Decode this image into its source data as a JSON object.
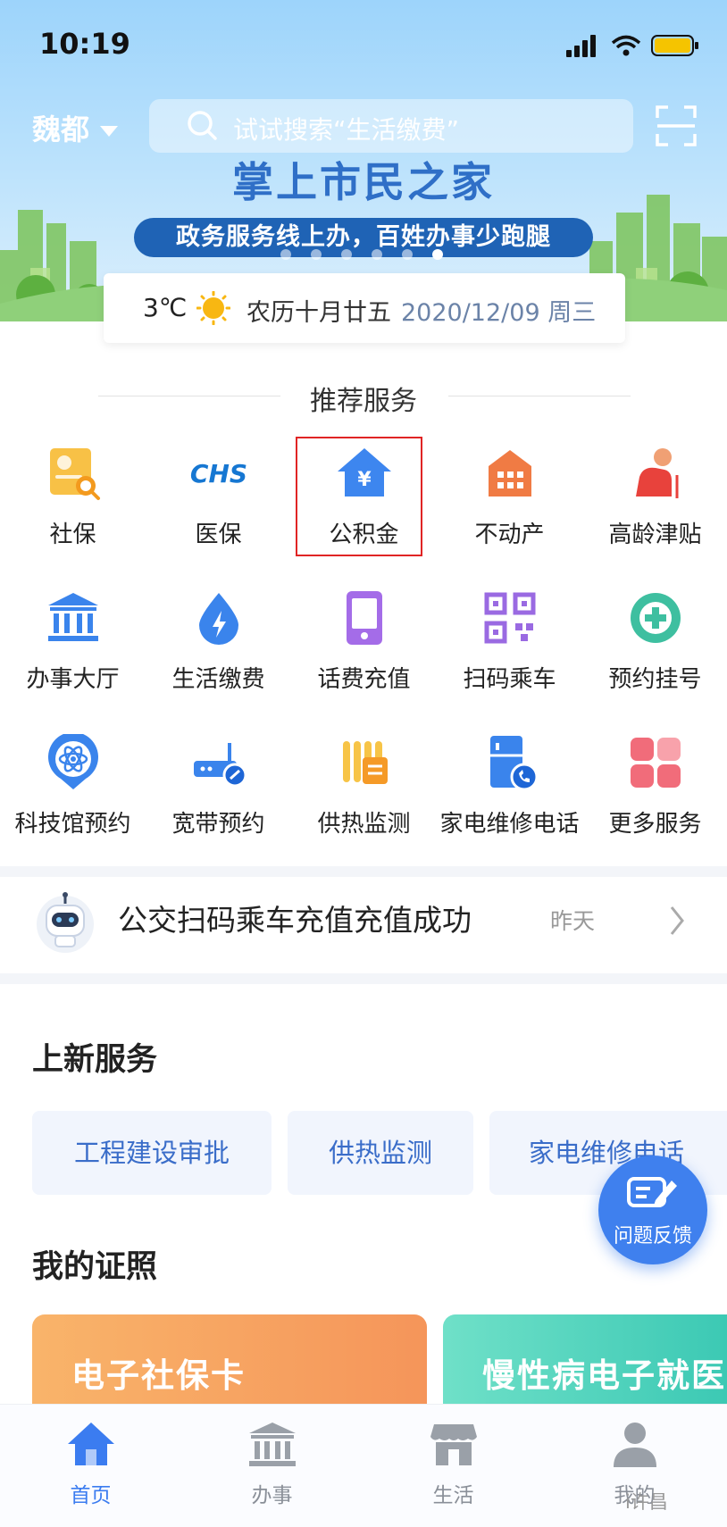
{
  "status_bar": {
    "time": "10:19"
  },
  "header": {
    "city": "魏都",
    "search_placeholder": "试试搜索“生活缴费”",
    "banner_title": "掌上市民之家",
    "banner_slogan": "政务服务线上办，百姓办事少跑腿",
    "banner_slide_count": 6,
    "banner_active_index": 5
  },
  "weather": {
    "temperature": "3℃",
    "lunar_date": "农历十月廿五",
    "date": "2020/12/09 周三"
  },
  "recommended": {
    "title": "推荐服务",
    "items": [
      {
        "label": "社保",
        "icon": "social-security-card-icon"
      },
      {
        "label": "医保",
        "icon": "medical-insurance-chs-icon"
      },
      {
        "label": "公积金",
        "icon": "housing-fund-house-icon"
      },
      {
        "label": "不动产",
        "icon": "real-estate-building-icon"
      },
      {
        "label": "高龄津贴",
        "icon": "elderly-allowance-icon"
      },
      {
        "label": "办事大厅",
        "icon": "government-hall-icon"
      },
      {
        "label": "生活缴费",
        "icon": "utility-payment-icon"
      },
      {
        "label": "话费充值",
        "icon": "phone-recharge-icon"
      },
      {
        "label": "扫码乘车",
        "icon": "qr-code-icon"
      },
      {
        "label": "预约挂号",
        "icon": "medical-appointment-icon"
      },
      {
        "label": "科技馆预约",
        "icon": "science-museum-icon"
      },
      {
        "label": "宽带预约",
        "icon": "broadband-router-icon"
      },
      {
        "label": "供热监测",
        "icon": "heating-radiator-icon"
      },
      {
        "label": "家电维修电话",
        "icon": "appliance-repair-icon"
      },
      {
        "label": "更多服务",
        "icon": "more-services-grid-icon"
      }
    ],
    "highlighted_item": "公积金"
  },
  "notice": {
    "message": "公交扫码乘车充值充值成功",
    "time": "昨天"
  },
  "new_services": {
    "title": "上新服务",
    "items": [
      "工程建设审批",
      "供热监测",
      "家电维修电话"
    ]
  },
  "my_certificates": {
    "title": "我的证照",
    "cards": [
      "电子社保卡",
      "慢性病电子就医"
    ]
  },
  "feedback_button": {
    "label": "问题反馈"
  },
  "tabbar": {
    "items": [
      {
        "label": "首页",
        "active": true
      },
      {
        "label": "办事",
        "active": false
      },
      {
        "label": "生活",
        "active": false
      },
      {
        "label": "我的",
        "active": false
      }
    ]
  },
  "watermark": "i许昌",
  "colors": {
    "accent": "#3b7cf0",
    "highlight_border": "#e02424",
    "slogan_bg": "#1f63b5",
    "chip_text": "#3a6dc9"
  }
}
